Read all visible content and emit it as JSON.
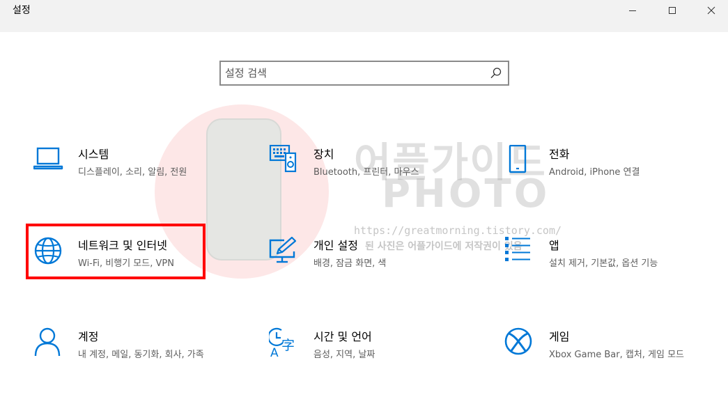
{
  "window": {
    "title": "설정",
    "controls": {
      "minimize_icon": "minimize-icon",
      "maximize_icon": "maximize-icon",
      "close_icon": "close-icon"
    }
  },
  "search": {
    "placeholder": "설정 검색",
    "icon": "search-icon"
  },
  "categories": [
    {
      "name": "시스템",
      "desc": "디스플레이, 소리, 알림, 전원",
      "icon": "laptop-icon"
    },
    {
      "name": "장치",
      "desc": "Bluetooth, 프린터, 마우스",
      "icon": "devices-icon"
    },
    {
      "name": "전화",
      "desc": "Android, iPhone 연결",
      "icon": "phone-icon"
    },
    {
      "name": "네트워크 및 인터넷",
      "desc": "Wi-Fi, 비행기 모드, VPN",
      "icon": "globe-icon"
    },
    {
      "name": "개인 설정",
      "desc": "배경, 잠금 화면, 색",
      "icon": "personalization-icon"
    },
    {
      "name": "앱",
      "desc": "설치 제거, 기본값, 옵션 기능",
      "icon": "apps-icon"
    },
    {
      "name": "계정",
      "desc": "내 계정, 메일, 동기화, 회사, 가족",
      "icon": "account-icon"
    },
    {
      "name": "시간 및 언어",
      "desc": "음성, 지역, 날짜",
      "icon": "time-language-icon"
    },
    {
      "name": "게임",
      "desc": "Xbox Game Bar, 캡처, 게임 모드",
      "icon": "xbox-icon"
    }
  ],
  "watermark": {
    "line1": "어플가이드",
    "line2": "PHOTO",
    "url": "https://greatmorning.tistory.com/",
    "copyright": "된 사진은 어플가이드에 저작권이 있음"
  },
  "colors": {
    "accent": "#0078d7",
    "highlight": "#ff0000",
    "titlebar": "#f2f2f2"
  }
}
